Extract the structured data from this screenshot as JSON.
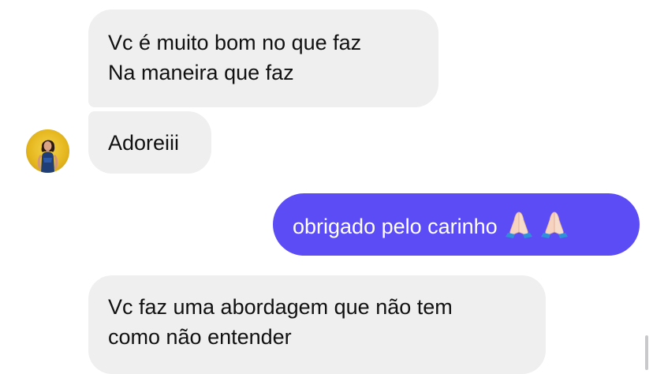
{
  "messages": [
    {
      "direction": "incoming",
      "lines": [
        "Vc é muito bom no que faz",
        "Na maneira que faz"
      ]
    },
    {
      "direction": "incoming",
      "lines": [
        "Adoreiii"
      ]
    },
    {
      "direction": "outgoing",
      "text": "obrigado pelo carinho",
      "emojis": [
        "folded-hands-icon",
        "folded-hands-icon"
      ]
    },
    {
      "direction": "incoming",
      "lines": [
        "Vc faz uma abordagem que não tem",
        "como não entender"
      ]
    }
  ],
  "colors": {
    "incoming_bubble": "#efeff0",
    "outgoing_bubble": "#5b4cf6",
    "avatar_background": "#e6b820"
  }
}
